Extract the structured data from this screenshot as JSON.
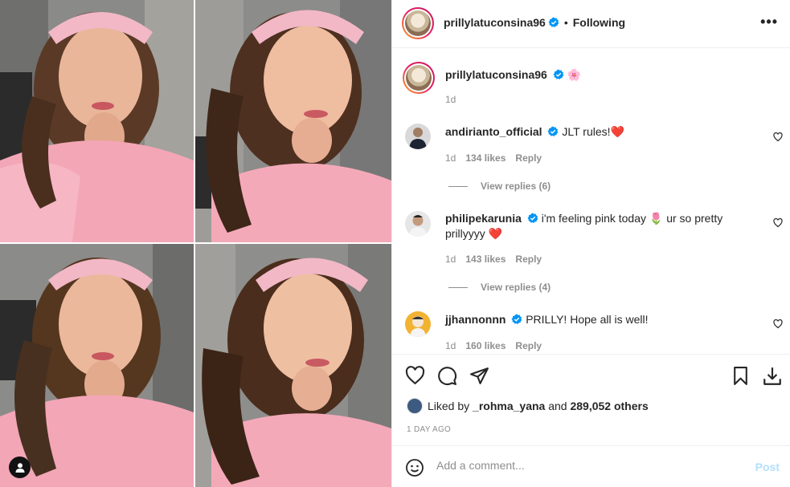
{
  "header": {
    "username": "prillylatuconsina96",
    "separator": "•",
    "follow_status": "Following",
    "more_icon": "more-horizontal-icon"
  },
  "caption": {
    "username": "prillylatuconsina96",
    "text": "🌸",
    "time": "1d"
  },
  "comments": [
    {
      "username": "andirianto_official",
      "text": "JLT rules!❤️",
      "time": "1d",
      "likes": "134 likes",
      "reply": "Reply",
      "view_replies": "View replies (6)"
    },
    {
      "username": "philipekarunia",
      "text": "i'm feeling pink today 🌷 ur so pretty prillyyyy ❤️",
      "time": "1d",
      "likes": "143 likes",
      "reply": "Reply",
      "view_replies": "View replies (4)"
    },
    {
      "username": "jjhannonnn",
      "text": "PRILLY! Hope all is well!",
      "time": "1d",
      "likes": "160 likes",
      "reply": "Reply"
    }
  ],
  "actions": {
    "liked_prefix": "Liked by ",
    "liked_user": "_rohma_yana",
    "liked_and": " and ",
    "liked_others": "289,052 others",
    "date": "1 DAY AGO"
  },
  "add_comment": {
    "placeholder": "Add a comment...",
    "post_label": "Post"
  },
  "colors": {
    "verified": "#0095f6",
    "post_disabled": "#b2dffc",
    "secondary_text": "#8e8e8e"
  }
}
